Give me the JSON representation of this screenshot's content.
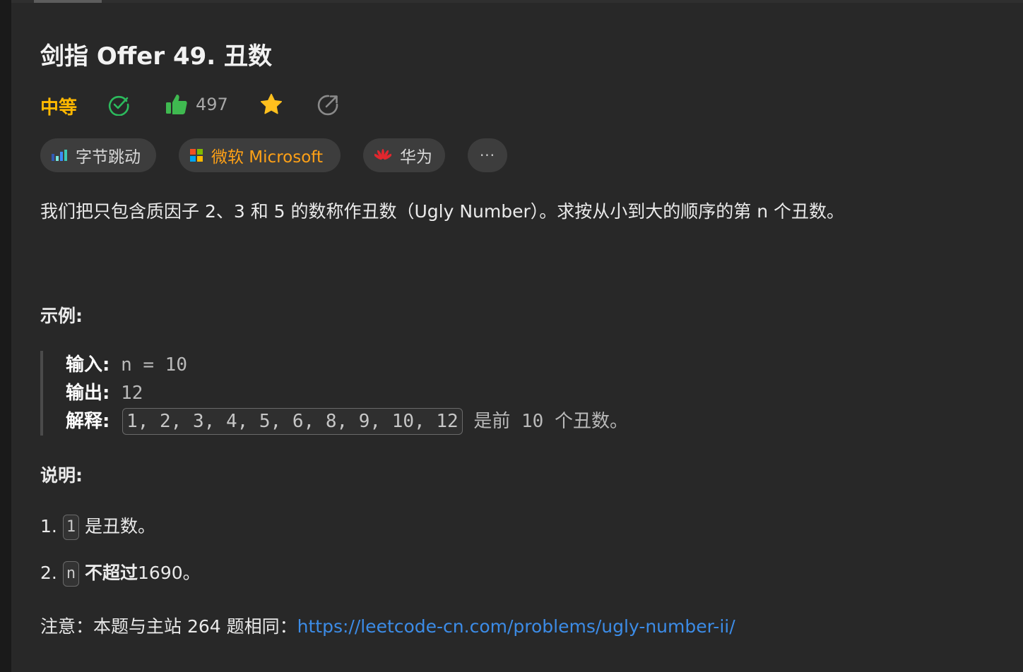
{
  "problem": {
    "title": "剑指 Offer 49. 丑数",
    "difficulty": "中等",
    "likes": "497",
    "colors": {
      "difficulty": "#ffb800",
      "accepted": "#2cbb5d",
      "like": "#3fb950",
      "star": "#ffc01e",
      "link": "#3c8ce7"
    },
    "icons": [
      "check-circle-icon",
      "thumbs-up-icon",
      "star-icon",
      "share-icon"
    ]
  },
  "tags": [
    {
      "label": "字节跳动",
      "icon": "bytedance-logo-icon"
    },
    {
      "label": "微软 Microsoft",
      "icon": "microsoft-logo-icon"
    },
    {
      "label": "华为",
      "icon": "huawei-logo-icon"
    },
    {
      "label": "···",
      "icon": "more-icon"
    }
  ],
  "description": "我们把只包含质因子 2、3 和 5 的数称作丑数（Ugly Number）。求按从小到大的顺序的第 n 个丑数。",
  "example": {
    "heading": "示例:",
    "input_label": "输入:",
    "input_value": "n = 10",
    "output_label": "输出:",
    "output_value": "12",
    "explain_label": "解释:",
    "explain_code": "1, 2, 3, 4, 5, 6, 8, 9, 10, 12",
    "explain_text": "是前 10 个丑数。"
  },
  "notes": {
    "heading": "说明:",
    "item1_prefix": "1.",
    "item1_code": "1",
    "item1_text": "是丑数。",
    "item2_prefix": "2.",
    "item2_code": "n",
    "item2_bold": "不超过",
    "item2_text": "1690。"
  },
  "footer": {
    "note_text": "注意：本题与主站 264 题相同：",
    "link": "https://leetcode-cn.com/problems/ugly-number-ii/"
  }
}
